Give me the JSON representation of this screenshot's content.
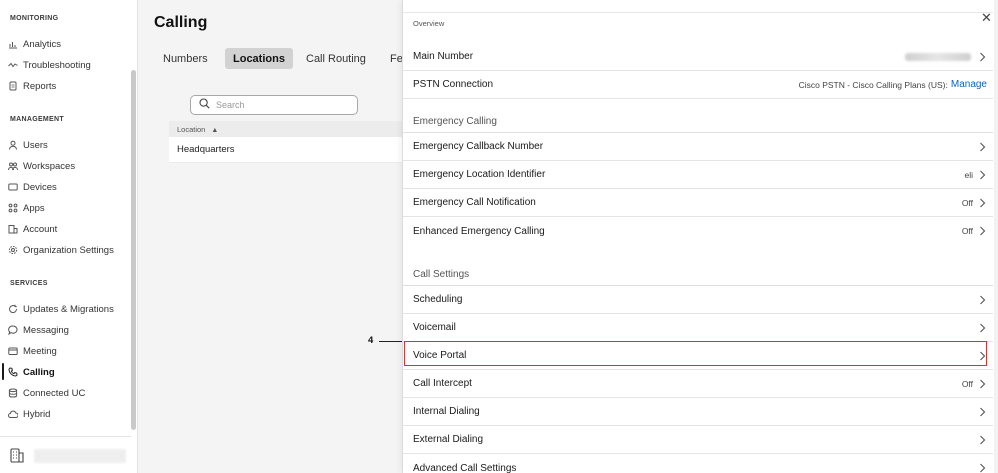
{
  "sidebar": {
    "monitoring_label": "MONITORING",
    "management_label": "MANAGEMENT",
    "services_label": "SERVICES",
    "monitoring": [
      {
        "label": "Analytics",
        "icon": "bar-chart-icon"
      },
      {
        "label": "Troubleshooting",
        "icon": "pulse-icon"
      },
      {
        "label": "Reports",
        "icon": "document-icon"
      }
    ],
    "management": [
      {
        "label": "Users",
        "icon": "user-icon"
      },
      {
        "label": "Workspaces",
        "icon": "people-icon"
      },
      {
        "label": "Devices",
        "icon": "device-icon"
      },
      {
        "label": "Apps",
        "icon": "grid-icon"
      },
      {
        "label": "Account",
        "icon": "building-icon"
      },
      {
        "label": "Organization Settings",
        "icon": "gear-icon"
      }
    ],
    "services": [
      {
        "label": "Updates & Migrations",
        "icon": "refresh-icon"
      },
      {
        "label": "Messaging",
        "icon": "chat-icon"
      },
      {
        "label": "Meeting",
        "icon": "calendar-icon"
      },
      {
        "label": "Calling",
        "icon": "phone-icon"
      },
      {
        "label": "Connected UC",
        "icon": "database-icon"
      },
      {
        "label": "Hybrid",
        "icon": "cloud-icon"
      }
    ]
  },
  "main": {
    "title": "Calling",
    "tabs": [
      "Numbers",
      "Locations",
      "Call Routing",
      "Fe"
    ],
    "active_tab": "Locations",
    "search_placeholder": "Search",
    "table_header": "Location",
    "rows": [
      "Headquarters"
    ]
  },
  "callout": {
    "number": "4"
  },
  "panel": {
    "crumb": "Overview",
    "overview_rows": [
      {
        "label": "Main Number",
        "value": ""
      },
      {
        "label": "PSTN Connection",
        "value": "Cisco PSTN - Cisco Calling Plans (US):",
        "link": "Manage"
      }
    ],
    "emergency_title": "Emergency Calling",
    "emergency_rows": [
      {
        "label": "Emergency Callback Number",
        "value": ""
      },
      {
        "label": "Emergency Location Identifier",
        "value": "eli"
      },
      {
        "label": "Emergency Call Notification",
        "value": "Off"
      },
      {
        "label": "Enhanced Emergency Calling",
        "value": "Off"
      }
    ],
    "call_settings_title": "Call Settings",
    "call_settings_rows": [
      {
        "label": "Scheduling",
        "value": ""
      },
      {
        "label": "Voicemail",
        "value": ""
      },
      {
        "label": "Voice Portal",
        "value": ""
      },
      {
        "label": "Call Intercept",
        "value": "Off"
      },
      {
        "label": "Internal Dialing",
        "value": ""
      },
      {
        "label": "External Dialing",
        "value": ""
      },
      {
        "label": "Advanced Call Settings",
        "value": ""
      }
    ]
  },
  "colors": {
    "highlight": "#d9342b",
    "link": "#0a63c9",
    "active_tab_bg": "#d2d2d2"
  }
}
